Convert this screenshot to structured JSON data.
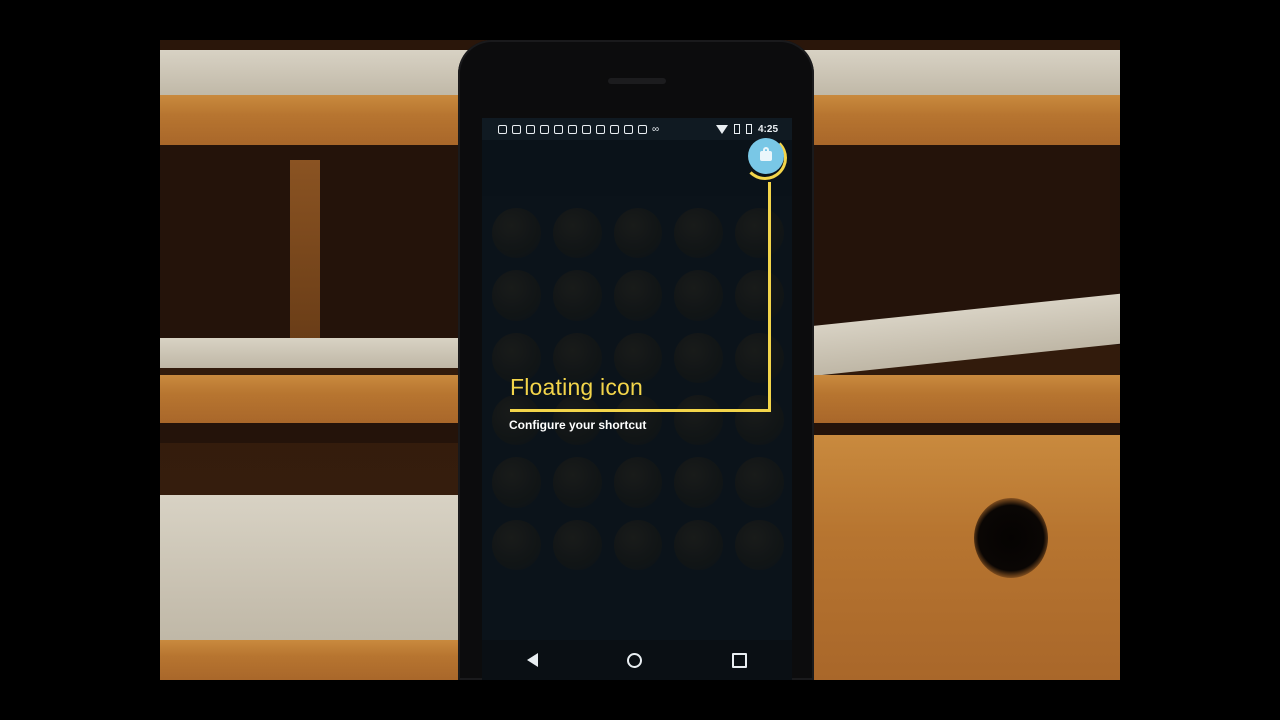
{
  "status_bar": {
    "time": "4:25",
    "notification_icons": [
      "cloud-icon",
      "facebook-icon",
      "facebook-icon",
      "facebook-icon",
      "facebook-icon",
      "facebook-icon",
      "facebook-icon",
      "facebook-icon",
      "facebook-icon",
      "facebook-icon",
      "facebook-icon",
      "infinity-icon"
    ],
    "system_icons": [
      "wifi-icon",
      "signal-icon",
      "battery-icon"
    ]
  },
  "tutorial": {
    "title": "Floating icon",
    "subtitle": "Configure your shortcut",
    "highlight_color": "#f3d54a"
  },
  "floating_button": {
    "icon": "lock-icon",
    "color": "#79c7e6"
  },
  "navigation": {
    "buttons": [
      "back-icon",
      "home-icon",
      "recents-icon"
    ]
  }
}
